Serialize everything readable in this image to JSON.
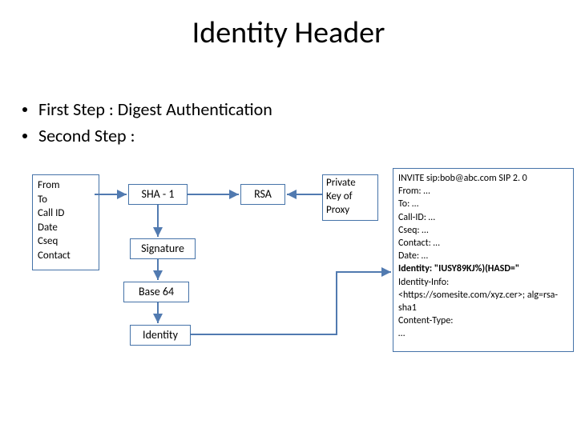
{
  "title": "Identity Header",
  "bullets": {
    "b1": "First Step : Digest Authentication",
    "b2": "Second Step :"
  },
  "boxes": {
    "headers": {
      "l1": "From",
      "l2": "To",
      "l3": "Call ID",
      "l4": "Date",
      "l5": "Cseq",
      "l6": "Contact"
    },
    "sha": "SHA - 1",
    "rsa": "RSA",
    "pkey": {
      "l1": "Private",
      "l2": "Key of",
      "l3": "Proxy"
    },
    "signature": "Signature",
    "base64": "Base 64",
    "identity": "Identity"
  },
  "msg": {
    "l1": "INVITE sip:bob@abc.com  SIP 2. 0",
    "l2": "From: …",
    "l3": "To: …",
    "l4": "Call-ID: …",
    "l5": "Cseq: …",
    "l6": "Contact: …",
    "l7": "Date: …",
    "l8a": "Identity: ",
    "l8b": "\"IUSY89KJ%)(HASD=\"",
    "l9": "Identity-Info:",
    "l10": "<https://somesite.com/xyz.cer>; alg=rsa-sha1",
    "l11": "Content-Type:",
    "l12": "…"
  }
}
